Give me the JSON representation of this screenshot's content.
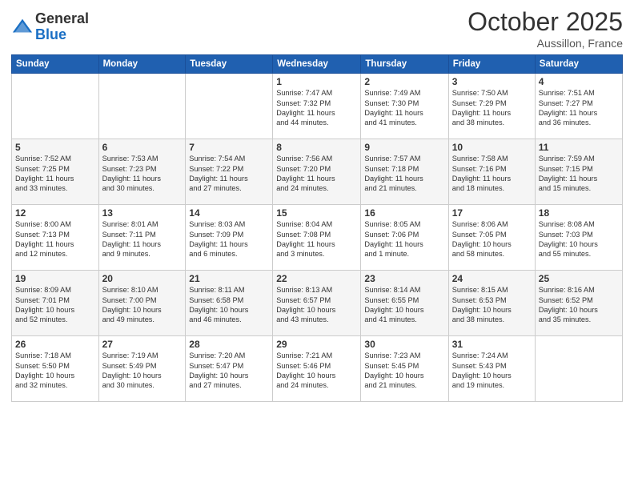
{
  "header": {
    "logo_general": "General",
    "logo_blue": "Blue",
    "month_title": "October 2025",
    "location": "Aussillon, France"
  },
  "days_of_week": [
    "Sunday",
    "Monday",
    "Tuesday",
    "Wednesday",
    "Thursday",
    "Friday",
    "Saturday"
  ],
  "weeks": [
    {
      "row_bg": "#fff",
      "days": [
        {
          "num": "",
          "info": ""
        },
        {
          "num": "",
          "info": ""
        },
        {
          "num": "",
          "info": ""
        },
        {
          "num": "1",
          "info": "Sunrise: 7:47 AM\nSunset: 7:32 PM\nDaylight: 11 hours\nand 44 minutes."
        },
        {
          "num": "2",
          "info": "Sunrise: 7:49 AM\nSunset: 7:30 PM\nDaylight: 11 hours\nand 41 minutes."
        },
        {
          "num": "3",
          "info": "Sunrise: 7:50 AM\nSunset: 7:29 PM\nDaylight: 11 hours\nand 38 minutes."
        },
        {
          "num": "4",
          "info": "Sunrise: 7:51 AM\nSunset: 7:27 PM\nDaylight: 11 hours\nand 36 minutes."
        }
      ]
    },
    {
      "row_bg": "#f5f5f5",
      "days": [
        {
          "num": "5",
          "info": "Sunrise: 7:52 AM\nSunset: 7:25 PM\nDaylight: 11 hours\nand 33 minutes."
        },
        {
          "num": "6",
          "info": "Sunrise: 7:53 AM\nSunset: 7:23 PM\nDaylight: 11 hours\nand 30 minutes."
        },
        {
          "num": "7",
          "info": "Sunrise: 7:54 AM\nSunset: 7:22 PM\nDaylight: 11 hours\nand 27 minutes."
        },
        {
          "num": "8",
          "info": "Sunrise: 7:56 AM\nSunset: 7:20 PM\nDaylight: 11 hours\nand 24 minutes."
        },
        {
          "num": "9",
          "info": "Sunrise: 7:57 AM\nSunset: 7:18 PM\nDaylight: 11 hours\nand 21 minutes."
        },
        {
          "num": "10",
          "info": "Sunrise: 7:58 AM\nSunset: 7:16 PM\nDaylight: 11 hours\nand 18 minutes."
        },
        {
          "num": "11",
          "info": "Sunrise: 7:59 AM\nSunset: 7:15 PM\nDaylight: 11 hours\nand 15 minutes."
        }
      ]
    },
    {
      "row_bg": "#fff",
      "days": [
        {
          "num": "12",
          "info": "Sunrise: 8:00 AM\nSunset: 7:13 PM\nDaylight: 11 hours\nand 12 minutes."
        },
        {
          "num": "13",
          "info": "Sunrise: 8:01 AM\nSunset: 7:11 PM\nDaylight: 11 hours\nand 9 minutes."
        },
        {
          "num": "14",
          "info": "Sunrise: 8:03 AM\nSunset: 7:09 PM\nDaylight: 11 hours\nand 6 minutes."
        },
        {
          "num": "15",
          "info": "Sunrise: 8:04 AM\nSunset: 7:08 PM\nDaylight: 11 hours\nand 3 minutes."
        },
        {
          "num": "16",
          "info": "Sunrise: 8:05 AM\nSunset: 7:06 PM\nDaylight: 11 hours\nand 1 minute."
        },
        {
          "num": "17",
          "info": "Sunrise: 8:06 AM\nSunset: 7:05 PM\nDaylight: 10 hours\nand 58 minutes."
        },
        {
          "num": "18",
          "info": "Sunrise: 8:08 AM\nSunset: 7:03 PM\nDaylight: 10 hours\nand 55 minutes."
        }
      ]
    },
    {
      "row_bg": "#f5f5f5",
      "days": [
        {
          "num": "19",
          "info": "Sunrise: 8:09 AM\nSunset: 7:01 PM\nDaylight: 10 hours\nand 52 minutes."
        },
        {
          "num": "20",
          "info": "Sunrise: 8:10 AM\nSunset: 7:00 PM\nDaylight: 10 hours\nand 49 minutes."
        },
        {
          "num": "21",
          "info": "Sunrise: 8:11 AM\nSunset: 6:58 PM\nDaylight: 10 hours\nand 46 minutes."
        },
        {
          "num": "22",
          "info": "Sunrise: 8:13 AM\nSunset: 6:57 PM\nDaylight: 10 hours\nand 43 minutes."
        },
        {
          "num": "23",
          "info": "Sunrise: 8:14 AM\nSunset: 6:55 PM\nDaylight: 10 hours\nand 41 minutes."
        },
        {
          "num": "24",
          "info": "Sunrise: 8:15 AM\nSunset: 6:53 PM\nDaylight: 10 hours\nand 38 minutes."
        },
        {
          "num": "25",
          "info": "Sunrise: 8:16 AM\nSunset: 6:52 PM\nDaylight: 10 hours\nand 35 minutes."
        }
      ]
    },
    {
      "row_bg": "#fff",
      "days": [
        {
          "num": "26",
          "info": "Sunrise: 7:18 AM\nSunset: 5:50 PM\nDaylight: 10 hours\nand 32 minutes."
        },
        {
          "num": "27",
          "info": "Sunrise: 7:19 AM\nSunset: 5:49 PM\nDaylight: 10 hours\nand 30 minutes."
        },
        {
          "num": "28",
          "info": "Sunrise: 7:20 AM\nSunset: 5:47 PM\nDaylight: 10 hours\nand 27 minutes."
        },
        {
          "num": "29",
          "info": "Sunrise: 7:21 AM\nSunset: 5:46 PM\nDaylight: 10 hours\nand 24 minutes."
        },
        {
          "num": "30",
          "info": "Sunrise: 7:23 AM\nSunset: 5:45 PM\nDaylight: 10 hours\nand 21 minutes."
        },
        {
          "num": "31",
          "info": "Sunrise: 7:24 AM\nSunset: 5:43 PM\nDaylight: 10 hours\nand 19 minutes."
        },
        {
          "num": "",
          "info": ""
        }
      ]
    }
  ]
}
